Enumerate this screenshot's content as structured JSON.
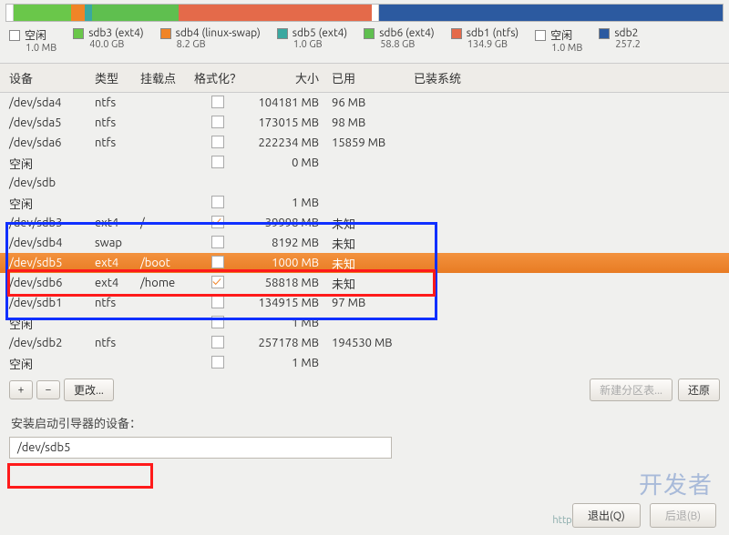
{
  "legend": [
    {
      "label": "空闲",
      "sub": "1.0 MB",
      "color": "c-empty"
    },
    {
      "label": "sdb3 (ext4)",
      "sub": "40.0 GB",
      "color": "c-green"
    },
    {
      "label": "sdb4 (linux-swap)",
      "sub": "8.2 GB",
      "color": "c-orange"
    },
    {
      "label": "sdb5 (ext4)",
      "sub": "1.0 GB",
      "color": "c-teal"
    },
    {
      "label": "sdb6 (ext4)",
      "sub": "58.8 GB",
      "color": "c-green2"
    },
    {
      "label": "sdb1 (ntfs)",
      "sub": "134.9 GB",
      "color": "c-red"
    },
    {
      "label": "空闲",
      "sub": "1.0 MB",
      "color": "c-empty"
    },
    {
      "label": "sdb2",
      "sub": "257.2",
      "color": "c-blue"
    }
  ],
  "columns": {
    "dev": "设备",
    "type": "类型",
    "mount": "挂载点",
    "fmt": "格式化？",
    "size": "大小",
    "used": "已用",
    "sys": "已装系统"
  },
  "rows": [
    {
      "dev": "/dev/sda4",
      "type": "ntfs",
      "mount": "",
      "fmt": false,
      "size": "104181 MB",
      "used": "96 MB",
      "indent": true
    },
    {
      "dev": "/dev/sda5",
      "type": "ntfs",
      "mount": "",
      "fmt": false,
      "size": "173015 MB",
      "used": "98 MB",
      "indent": true
    },
    {
      "dev": "/dev/sda6",
      "type": "ntfs",
      "mount": "",
      "fmt": false,
      "size": "222234 MB",
      "used": "15859 MB",
      "indent": true
    },
    {
      "dev": "空闲",
      "type": "",
      "mount": "",
      "fmt": false,
      "size": "0 MB",
      "used": "",
      "indent": true
    },
    {
      "dev": "/dev/sdb",
      "type": "",
      "mount": "",
      "fmt": null,
      "size": "",
      "used": "",
      "indent": false
    },
    {
      "dev": "空闲",
      "type": "",
      "mount": "",
      "fmt": false,
      "size": "1 MB",
      "used": "",
      "indent": true
    },
    {
      "dev": "/dev/sdb3",
      "type": "ext4",
      "mount": "/",
      "fmt": true,
      "size": "39998 MB",
      "used": "未知",
      "indent": true
    },
    {
      "dev": "/dev/sdb4",
      "type": "swap",
      "mount": "",
      "fmt": false,
      "size": "8192 MB",
      "used": "未知",
      "indent": true
    },
    {
      "dev": "/dev/sdb5",
      "type": "ext4",
      "mount": "/boot",
      "fmt": true,
      "size": "1000 MB",
      "used": "未知",
      "indent": true,
      "selected": true
    },
    {
      "dev": "/dev/sdb6",
      "type": "ext4",
      "mount": "/home",
      "fmt": true,
      "size": "58818 MB",
      "used": "未知",
      "indent": true
    },
    {
      "dev": "/dev/sdb1",
      "type": "ntfs",
      "mount": "",
      "fmt": false,
      "size": "134915 MB",
      "used": "97 MB",
      "indent": true
    },
    {
      "dev": "空闲",
      "type": "",
      "mount": "",
      "fmt": false,
      "size": "1 MB",
      "used": "",
      "indent": true
    },
    {
      "dev": "/dev/sdb2",
      "type": "ntfs",
      "mount": "",
      "fmt": false,
      "size": "257178 MB",
      "used": "194530 MB",
      "indent": true
    },
    {
      "dev": "空闲",
      "type": "",
      "mount": "",
      "fmt": false,
      "size": "1 MB",
      "used": "",
      "indent": true
    }
  ],
  "buttons": {
    "add": "+",
    "remove": "−",
    "change": "更改...",
    "new_table": "新建分区表...",
    "revert": "还原"
  },
  "boot": {
    "label": "安装启动引导器的设备：",
    "value": "/dev/sdb5"
  },
  "footer": {
    "quit": "退出(Q)",
    "back": "后退(B)"
  },
  "watermark": "开发者",
  "urlhint": "https://DevZe.CoM"
}
